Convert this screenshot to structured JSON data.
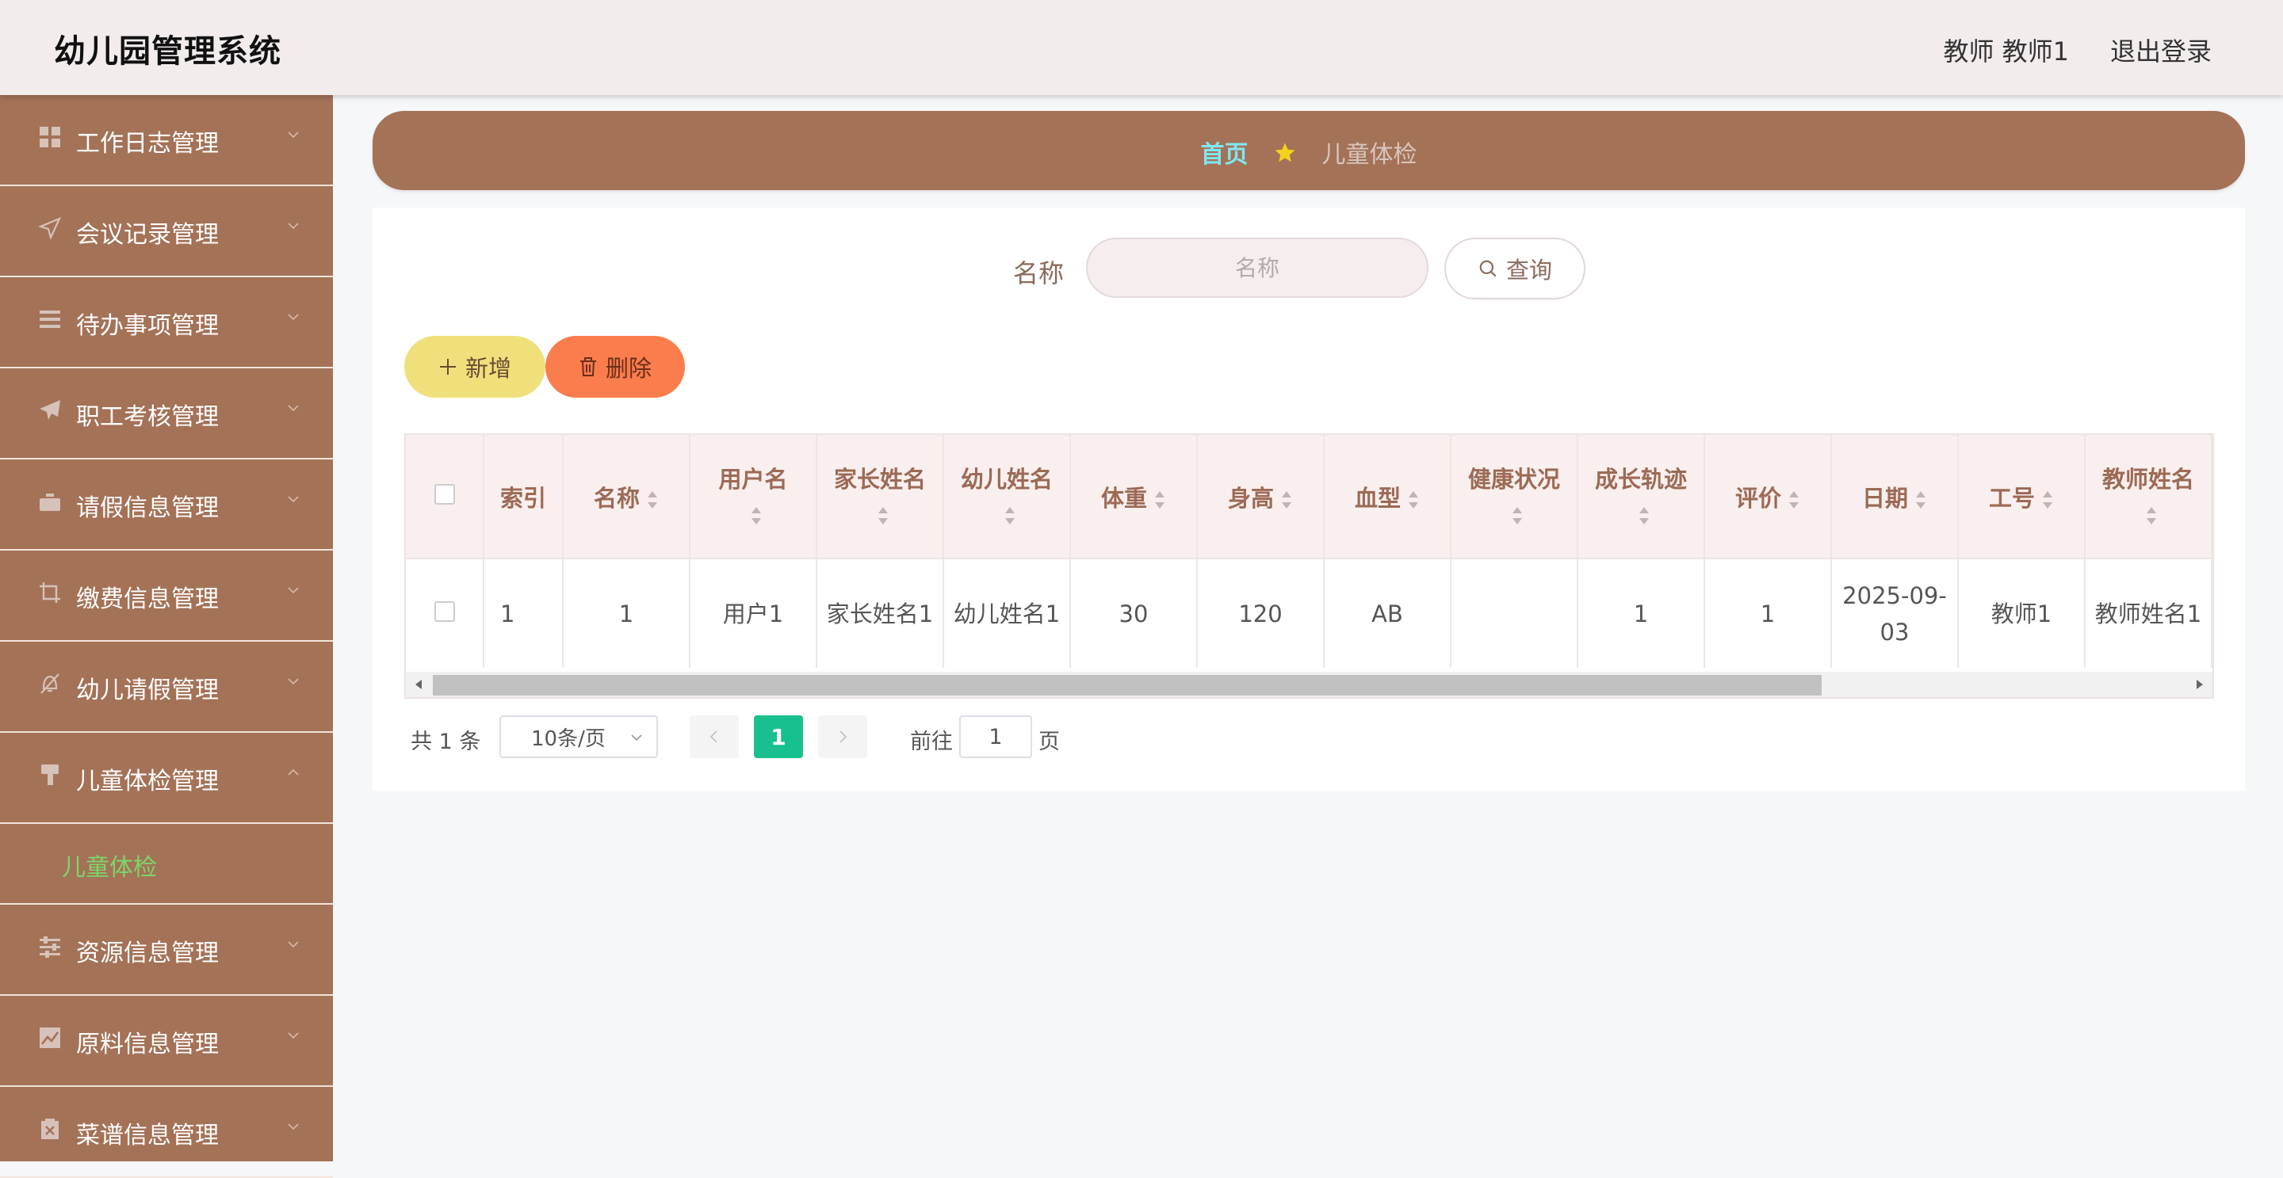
{
  "header": {
    "title": "幼儿园管理系统",
    "user": "教师 教师1",
    "logout": "退出登录"
  },
  "sidebar": {
    "items": [
      {
        "label": "工作日志管理",
        "icon": "grid-icon"
      },
      {
        "label": "会议记录管理",
        "icon": "send-icon"
      },
      {
        "label": "待办事项管理",
        "icon": "list-icon"
      },
      {
        "label": "职工考核管理",
        "icon": "paper-plane-icon"
      },
      {
        "label": "请假信息管理",
        "icon": "suitcase-icon"
      },
      {
        "label": "缴费信息管理",
        "icon": "crop-icon"
      },
      {
        "label": "幼儿请假管理",
        "icon": "bell-off-icon"
      },
      {
        "label": "儿童体检管理",
        "icon": "brush-icon",
        "expanded": true
      },
      {
        "label": "资源信息管理",
        "icon": "sliders-icon"
      },
      {
        "label": "原料信息管理",
        "icon": "chart-icon"
      },
      {
        "label": "菜谱信息管理",
        "icon": "box-icon"
      }
    ],
    "active_sub": "儿童体检"
  },
  "breadcrumb": {
    "home": "首页",
    "current": "儿童体检"
  },
  "search": {
    "label": "名称",
    "placeholder": "名称",
    "button": "查询"
  },
  "actions": {
    "add": "新增",
    "delete": "删除"
  },
  "table": {
    "columns": [
      "索引",
      "名称",
      "用户名",
      "家长姓名",
      "幼儿姓名",
      "体重",
      "身高",
      "血型",
      "健康状况",
      "成长轨迹",
      "评价",
      "日期",
      "工号",
      "教师姓名"
    ],
    "rows": [
      [
        "1",
        "1",
        "用户1",
        "家长姓名1",
        "幼儿姓名1",
        "30",
        "120",
        "AB",
        "",
        "1",
        "1",
        "2025-09-03",
        "教师1",
        "教师姓名1"
      ]
    ]
  },
  "pagination": {
    "total": "共 1 条",
    "page_size": "10条/页",
    "current_page": "1",
    "goto_label": "前往",
    "goto_value": "1",
    "page_suffix": "页"
  },
  "colors": {
    "sidebar": "#a47257",
    "header": "#f3ecec",
    "active_submenu": "#7dd66a",
    "pagination_active": "#19c08f"
  }
}
